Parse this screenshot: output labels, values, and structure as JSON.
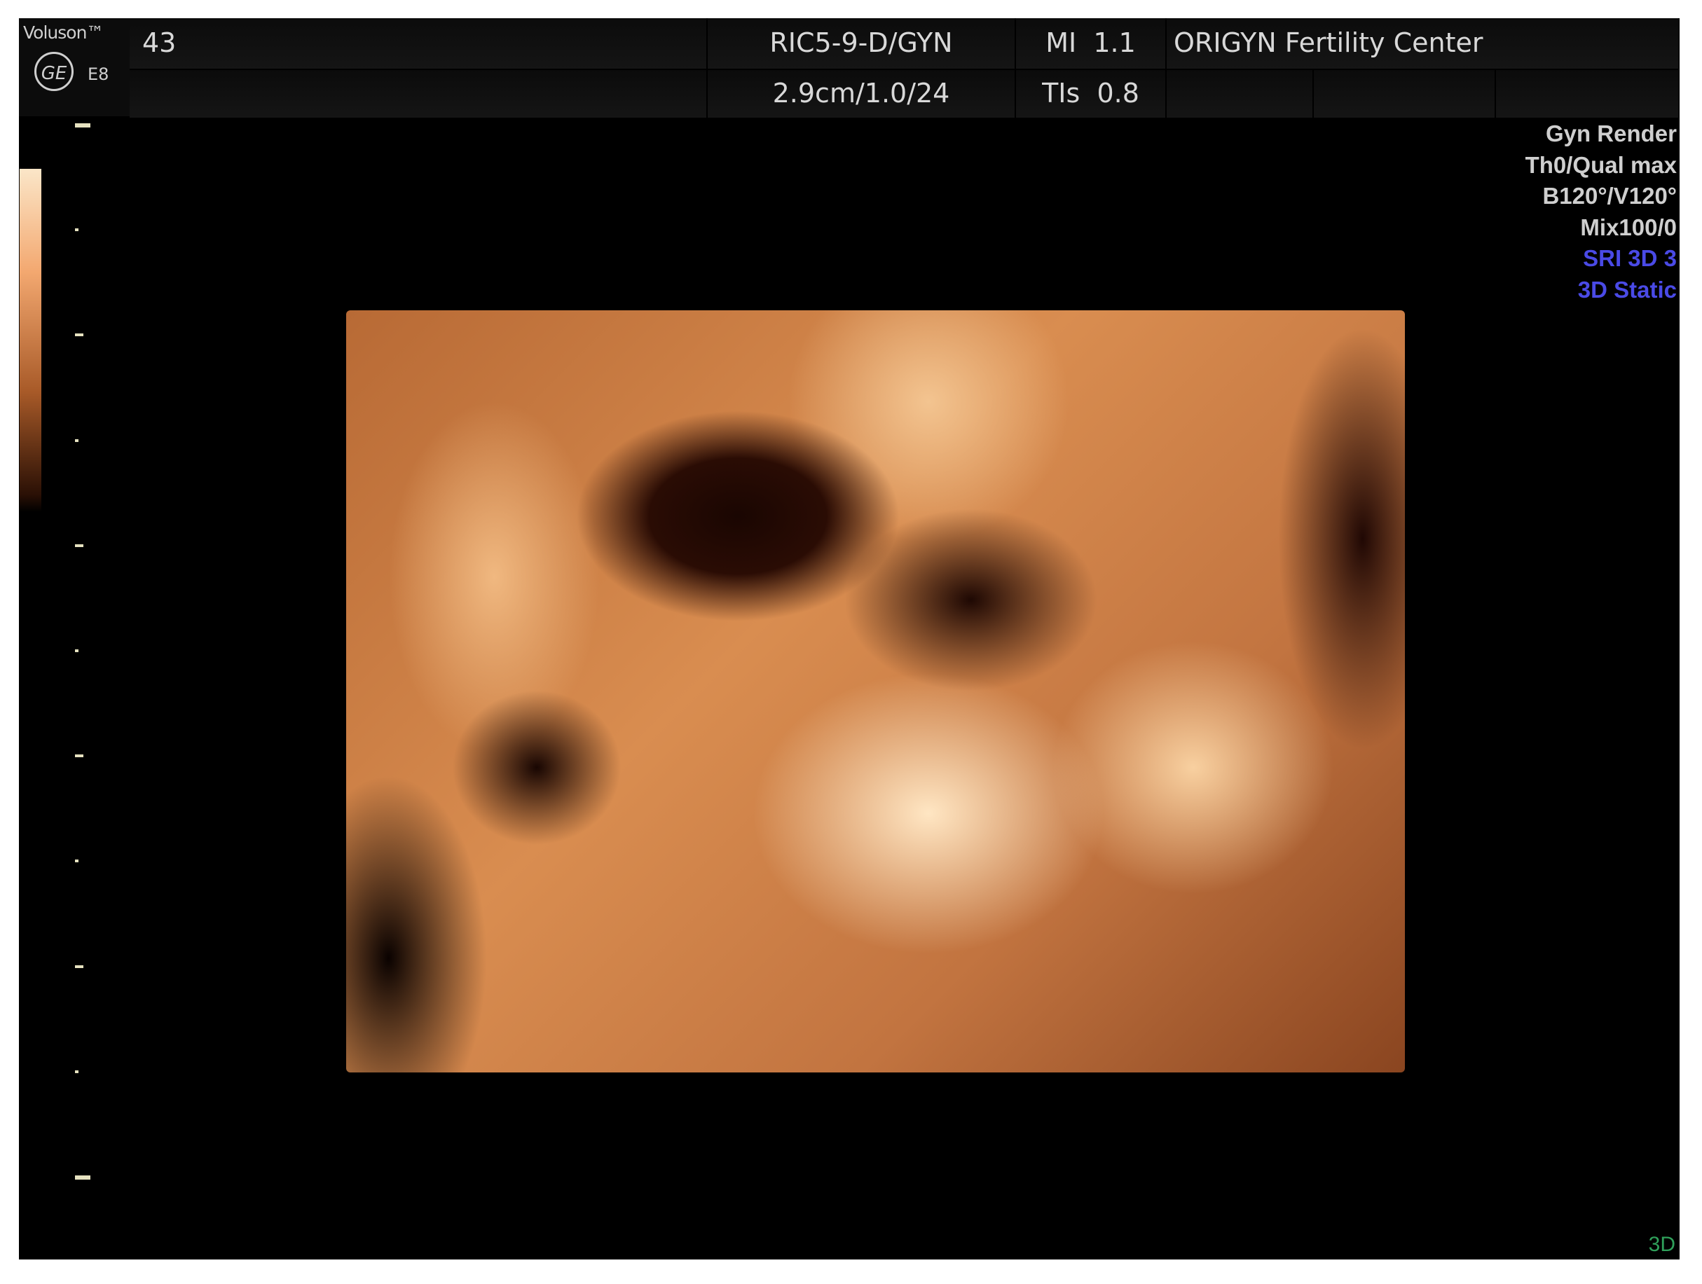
{
  "header": {
    "brand": "Voluson™",
    "logo": "GE",
    "model": "E8",
    "frame_rate": "43",
    "probe": "RIC5-9-D/GYN",
    "depth": "2.9cm/1.0/24",
    "mi": "MI  1.1",
    "tis": "TIs  0.8",
    "institution": "ORIGYN Fertility Center"
  },
  "params": [
    "Gyn Render",
    "Th0/Qual max",
    "B120°/V120°",
    "Mix100/0"
  ],
  "params_blue": [
    "SRI 3D 3",
    "3D Static"
  ],
  "mode_indicator": "3D",
  "colors": {
    "mode": "#2fa05a",
    "blue_params": "#4a4ae6",
    "tint": "#d98d50"
  }
}
